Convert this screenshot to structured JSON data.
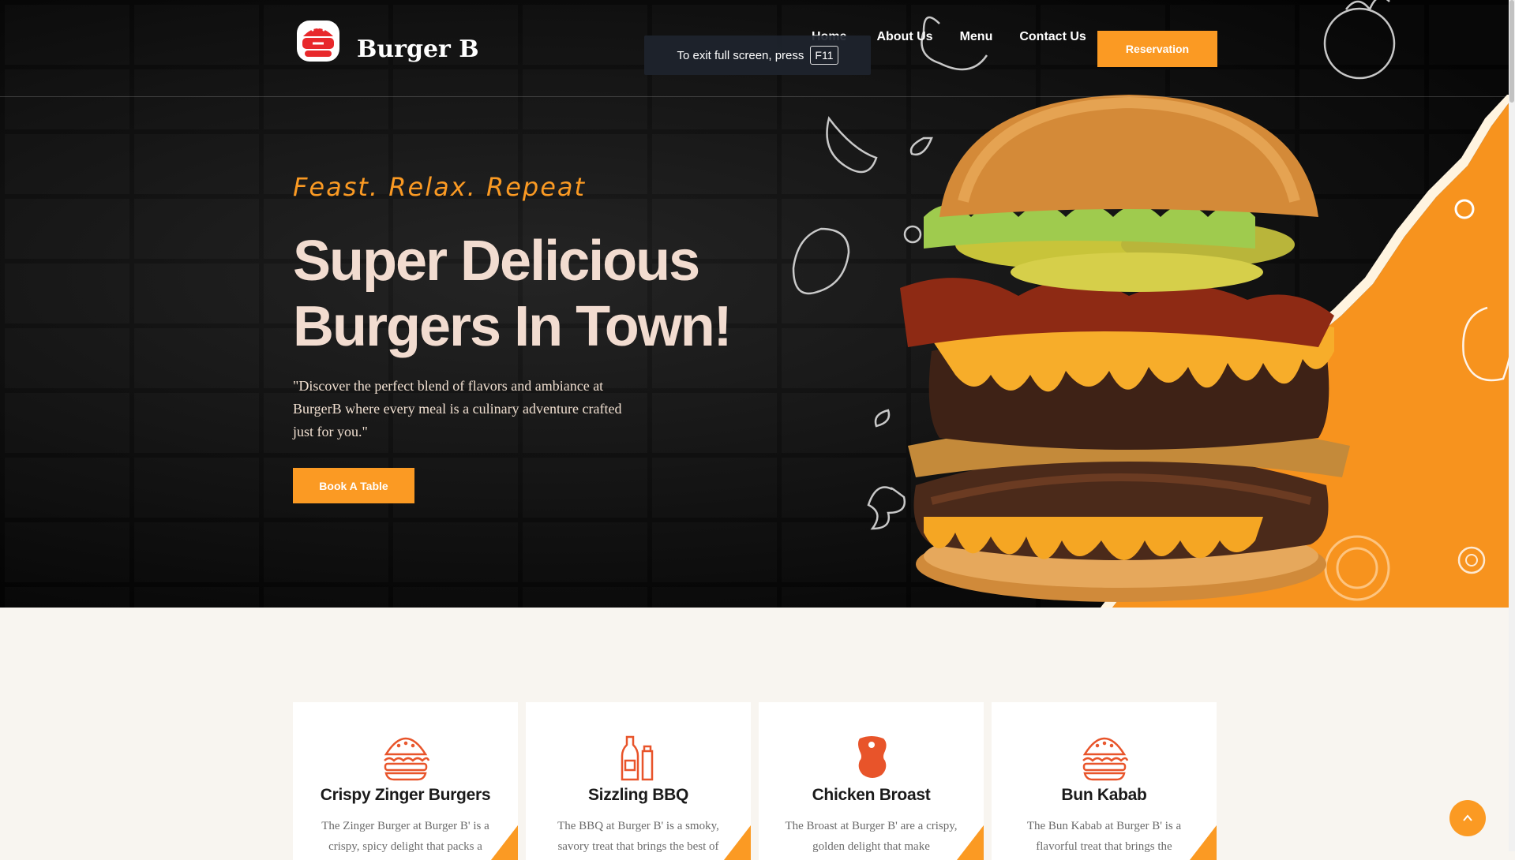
{
  "brand": {
    "name": "Burger B"
  },
  "nav": {
    "items": [
      "Home",
      "About Us",
      "Menu",
      "Contact Us"
    ],
    "reservation_label": "Reservation"
  },
  "fullscreen_notice": {
    "text": "To exit full screen, press",
    "key": "F11"
  },
  "hero": {
    "tagline": "Feast. Relax. Repeat",
    "headline_line1": "Super Delicious",
    "headline_line2": "Burgers In Town!",
    "description": "\"Discover the perfect blend of flavors and ambiance at BurgerB where every meal is a culinary adventure crafted just for you.\"",
    "cta_label": "Book A Table"
  },
  "cards": [
    {
      "icon": "burger-icon",
      "title": "Crispy Zinger Burgers",
      "desc": "The Zinger Burger at Burger B' is a crispy, spicy delight that packs a"
    },
    {
      "icon": "bbq-bottles-icon",
      "title": "Sizzling BBQ",
      "desc": "The BBQ at Burger B' is a smoky, savory treat that brings the best of"
    },
    {
      "icon": "chicken-icon",
      "title": "Chicken Broast",
      "desc": "The Broast at Burger B' are a crispy, golden delight that make"
    },
    {
      "icon": "burger-icon",
      "title": "Bun Kabab",
      "desc": "The Bun Kabab at Burger B' is a flavorful treat that brings the"
    }
  ],
  "colors": {
    "accent": "#fb9a23",
    "dark": "#1c1c1c",
    "headline": "#f2dcd0",
    "page_bg": "#f8f5f0"
  }
}
